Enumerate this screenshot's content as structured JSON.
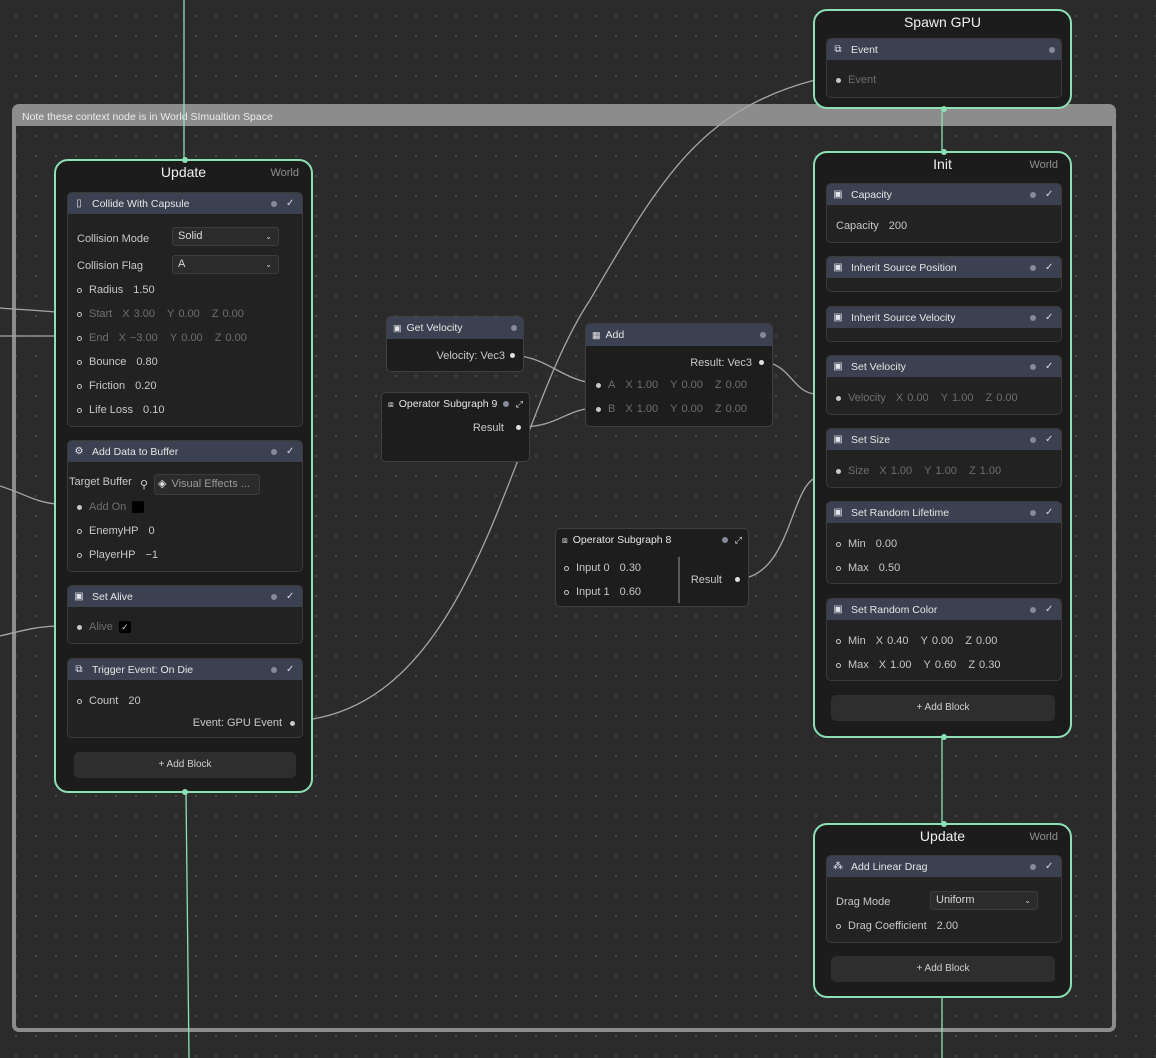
{
  "group": {
    "title": "Note these context node is in World SImualtion Space"
  },
  "spawn_gpu": {
    "title": "Spawn GPU",
    "block_title": "Event",
    "port_label": "Event"
  },
  "left_update": {
    "title": "Update",
    "space": "World",
    "collide": {
      "title": "Collide With Capsule",
      "collision_mode_label": "Collision Mode",
      "collision_mode": "Solid",
      "collision_flag_label": "Collision Flag",
      "collision_flag": "A",
      "radius_label": "Radius",
      "radius": "1.50",
      "start_label": "Start",
      "start": {
        "x": "3.00",
        "y": "0.00",
        "z": "0.00"
      },
      "end_label": "End",
      "end": {
        "x": "−3.00",
        "y": "0.00",
        "z": "0.00"
      },
      "bounce_label": "Bounce",
      "bounce": "0.80",
      "friction_label": "Friction",
      "friction": "0.20",
      "lifeloss_label": "Life Loss",
      "lifeloss": "0.10"
    },
    "buffer": {
      "title": "Add Data to Buffer",
      "target_label": "Target Buffer",
      "target_value": "Visual Effects ...",
      "addon_label": "Add On",
      "enemy_label": "EnemyHP",
      "enemy": "0",
      "player_label": "PlayerHP",
      "player": "−1"
    },
    "alive": {
      "title": "Set Alive",
      "alive_label": "Alive"
    },
    "trigger": {
      "title": "Trigger Event: On Die",
      "count_label": "Count",
      "count": "20",
      "event_out": "Event: GPU Event"
    },
    "add_block": "+ Add Block"
  },
  "get_velocity": {
    "title": "Get Velocity",
    "output": "Velocity: Vec3"
  },
  "op_subgraph9": {
    "title": "Operator Subgraph 9",
    "output": "Result"
  },
  "add_node": {
    "title": "Add",
    "output": "Result: Vec3",
    "a_label": "A",
    "a": {
      "x": "1.00",
      "y": "0.00",
      "z": "0.00"
    },
    "b_label": "B",
    "b": {
      "x": "1.00",
      "y": "0.00",
      "z": "0.00"
    }
  },
  "op_subgraph8": {
    "title": "Operator Subgraph 8",
    "input0_label": "Input 0",
    "input0": "0.30",
    "input1_label": "Input 1",
    "input1": "0.60",
    "output": "Result"
  },
  "init": {
    "title": "Init",
    "space": "World",
    "capacity": {
      "title": "Capacity",
      "label": "Capacity",
      "value": "200"
    },
    "inherit_pos": {
      "title": "Inherit Source Position"
    },
    "inherit_vel": {
      "title": "Inherit Source Velocity"
    },
    "set_velocity": {
      "title": "Set Velocity",
      "label": "Velocity",
      "x": "0.00",
      "y": "1.00",
      "z": "0.00"
    },
    "set_size": {
      "title": "Set Size",
      "label": "Size",
      "x": "1.00",
      "y": "1.00",
      "z": "1.00"
    },
    "lifetime": {
      "title": "Set Random Lifetime",
      "min_label": "Min",
      "min": "0.00",
      "max_label": "Max",
      "max": "0.50"
    },
    "color": {
      "title": "Set Random Color",
      "min_label": "Min",
      "min": {
        "x": "0.40",
        "y": "0.00",
        "z": "0.00"
      },
      "max_label": "Max",
      "max": {
        "x": "1.00",
        "y": "0.60",
        "z": "0.30"
      }
    },
    "add_block": "+ Add Block"
  },
  "right_update": {
    "title": "Update",
    "space": "World",
    "drag": {
      "title": "Add Linear Drag",
      "mode_label": "Drag Mode",
      "mode": "Uniform",
      "coef_label": "Drag Coefficient",
      "coef": "2.00"
    },
    "add_block": "+ Add Block"
  },
  "axis": {
    "x": "X",
    "y": "Y",
    "z": "Z"
  },
  "colors": {
    "context_border": "#8de0b5",
    "block_header": "#3b4151",
    "group_frame": "#8c8c8c",
    "background": "#2b2b2b"
  },
  "icons": [
    "capsule-icon",
    "gear-icon",
    "attribute-icon",
    "event-icon",
    "drag-icon",
    "subgraph-icon",
    "info-icon",
    "check-icon",
    "layers-icon",
    "expand-icon"
  ]
}
